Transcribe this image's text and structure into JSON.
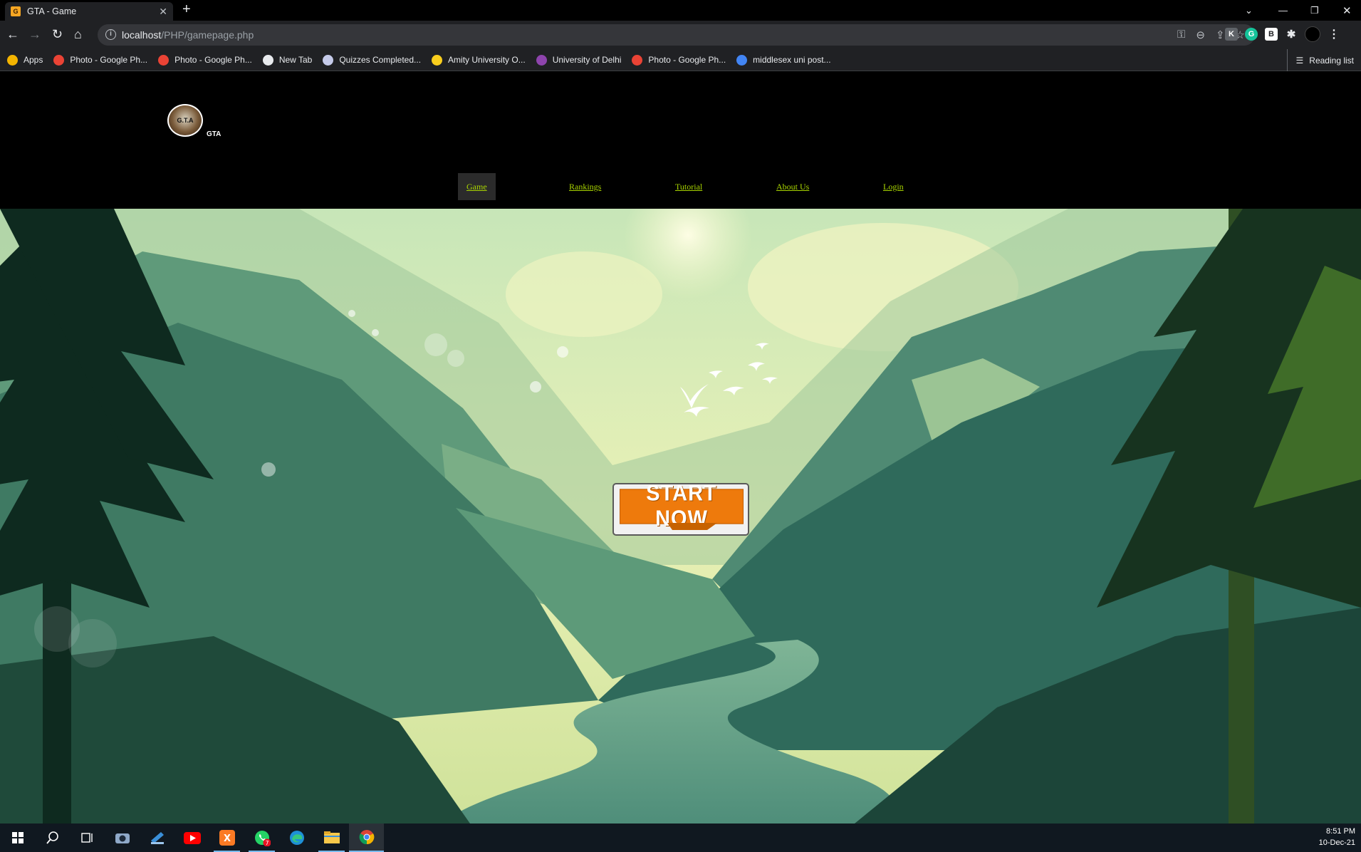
{
  "browser": {
    "tab_title": "GTA - Game",
    "tab_close": "✕",
    "new_tab": "+",
    "url_host": "localhost",
    "url_path": "/PHP/gamepage.php",
    "bookmarks": [
      {
        "label": "Apps",
        "color": "#f4b400"
      },
      {
        "label": "Photo - Google Ph...",
        "color": "#ea4335"
      },
      {
        "label": "Photo - Google Ph...",
        "color": "#ea4335"
      },
      {
        "label": "New Tab",
        "color": "#e8eaed"
      },
      {
        "label": "Quizzes Completed...",
        "color": "#c5cae9"
      },
      {
        "label": "Amity University O...",
        "color": "#f9ce1d"
      },
      {
        "label": "University of Delhi",
        "color": "#8e44ad"
      },
      {
        "label": "Photo - Google Ph...",
        "color": "#ea4335"
      },
      {
        "label": "middlesex uni post...",
        "color": "#4285f4"
      }
    ],
    "reading_list": "Reading list"
  },
  "site": {
    "logo_text": "G.T.A",
    "brand": "GTA",
    "nav": [
      {
        "label": "Game",
        "active": true
      },
      {
        "label": "Rankings",
        "active": false
      },
      {
        "label": "Tutorial",
        "active": false
      },
      {
        "label": "About Us",
        "active": false
      },
      {
        "label": "Login",
        "active": false
      }
    ],
    "cta": "START NOW",
    "accent_color": "#a8d400",
    "cta_color": "#ee7a0c"
  },
  "taskbar": {
    "time": "8:51 PM",
    "date": "10-Dec-21",
    "whatsapp_badge": "7",
    "apps": [
      "start-icon",
      "search-icon",
      "task-view-icon",
      "camera-icon",
      "editor-icon",
      "youtube-icon",
      "xampp-icon",
      "whatsapp-icon",
      "edge-icon",
      "file-explorer-icon",
      "chrome-icon"
    ]
  }
}
